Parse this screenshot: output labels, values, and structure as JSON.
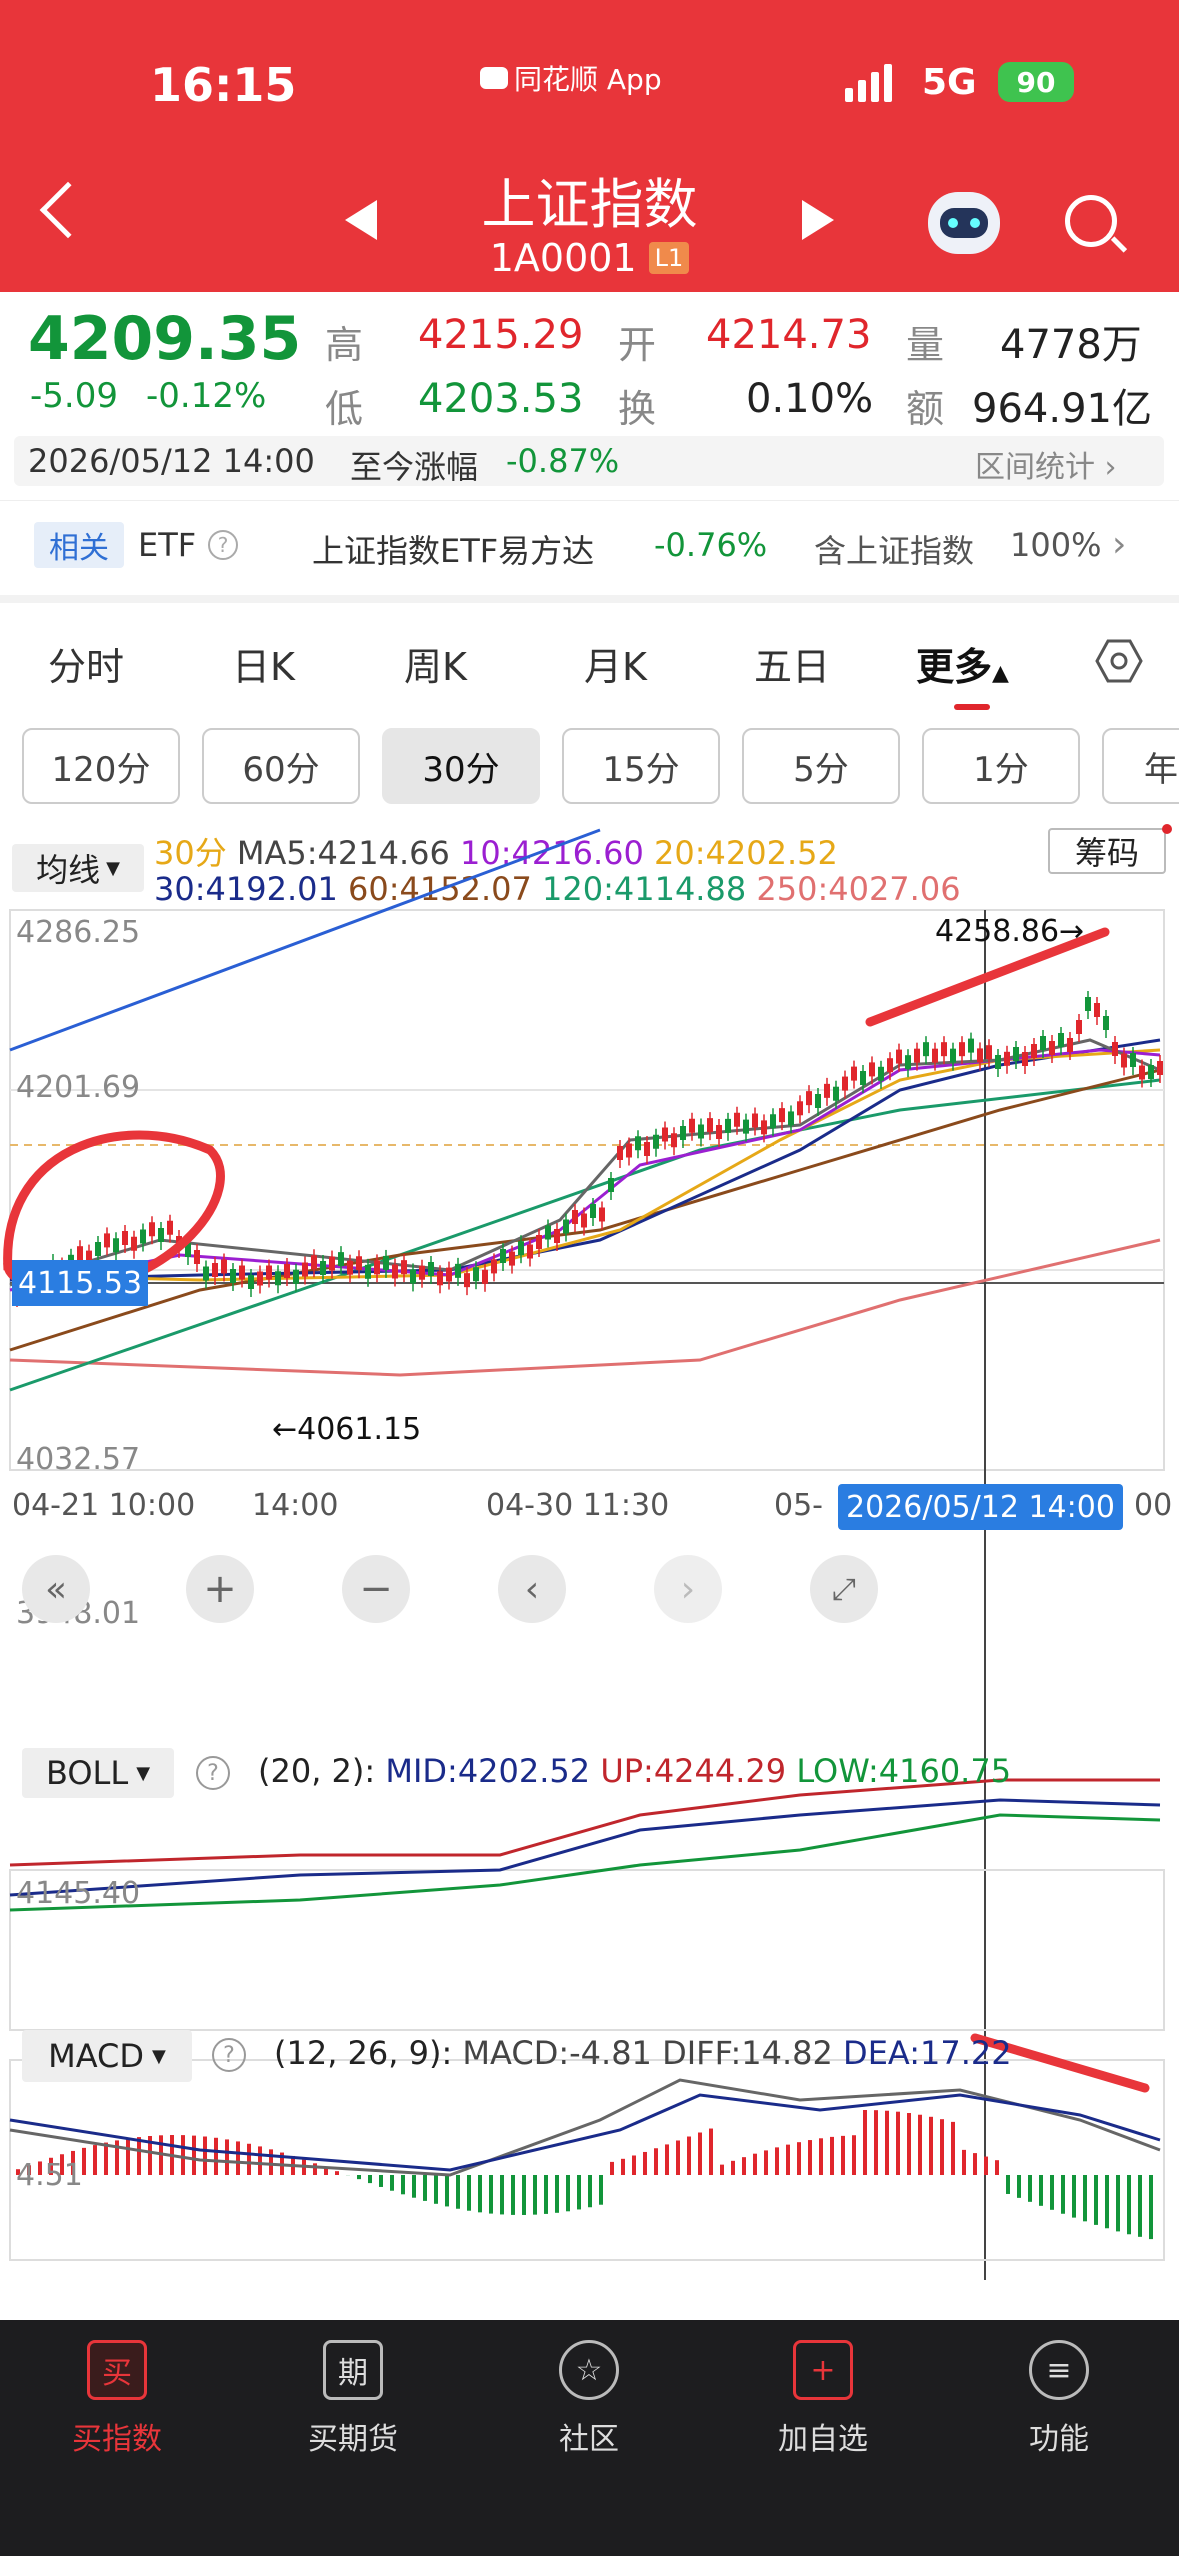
{
  "status_bar": {
    "time": "16:15",
    "center_app": "同花顺 App",
    "network": "5G",
    "battery": "90"
  },
  "header": {
    "title": "上证指数",
    "code": "1A0001",
    "level_badge": "L1"
  },
  "quote": {
    "price": "4209.35",
    "change": "-5.09",
    "change_pct": "-0.12%",
    "high_label": "高",
    "high": "4215.29",
    "open_label": "开",
    "open": "4214.73",
    "volume_label": "量",
    "volume": "4778万",
    "low_label": "低",
    "low": "4203.53",
    "turnover_label": "换",
    "turnover": "0.10%",
    "amount_label": "额",
    "amount": "964.91亿",
    "date_time": "2026/05/12 14:00",
    "since_label": "至今涨幅",
    "since_value": "-0.87%",
    "range_stats": "区间统计"
  },
  "etf_bar": {
    "tag": "相关",
    "etf_label": "ETF",
    "etf_name": "上证指数ETF易方达",
    "etf_change": "-0.76%",
    "contains_label": "含上证指数",
    "contains_value": "100%"
  },
  "period_tabs": [
    "分时",
    "日K",
    "周K",
    "月K",
    "五日",
    "更多"
  ],
  "interval_chips": [
    "120分",
    "60分",
    "30分",
    "15分",
    "5分",
    "1分",
    "年"
  ],
  "ma_legend": {
    "selector": "均线",
    "period": "30分",
    "ma5": "MA5:4214.66",
    "ma10": "10:4216.60",
    "ma20": "20:4202.52",
    "ma30": "30:4192.01",
    "ma60": "60:4152.07",
    "ma120": "120:4114.88",
    "ma250": "250:4027.06",
    "chips_button": "筹码"
  },
  "main_axis": {
    "y1": "4286.25",
    "y2": "4201.69",
    "y3": "4032.57",
    "y4": "3948.01",
    "cursor_price": "4115.53"
  },
  "annotations": {
    "high": "4258.86→",
    "low": "←4061.15"
  },
  "time_axis": {
    "t1": "04-21 10:00",
    "t2": "14:00",
    "t3": "04-30 11:30",
    "t4": "05-",
    "cursor_time": "2026/05/12 14:00",
    "t5": "00"
  },
  "boll": {
    "name": "BOLL",
    "params": "(20, 2):",
    "mid": "MID:4202.52",
    "up": "UP:4244.29",
    "low": "LOW:4160.75",
    "axis": "4145.40"
  },
  "macd": {
    "name": "MACD",
    "params": "(12, 26, 9):",
    "macd": "MACD:-4.81",
    "diff": "DIFF:14.82",
    "dea": "DEA:17.22",
    "axis": "4.51"
  },
  "bottom_nav": [
    {
      "icon": "买",
      "label": "买指数"
    },
    {
      "icon": "期",
      "label": "买期货"
    },
    {
      "icon": "☆",
      "label": "社区"
    },
    {
      "icon": "+",
      "label": "加自选"
    },
    {
      "icon": "≡",
      "label": "功能"
    }
  ],
  "colors": {
    "up": "#e0262c",
    "down": "#12953a",
    "header": "#e8353a",
    "ma5": "#555555",
    "ma10": "#9b1fd1",
    "ma20": "#e6a817",
    "ma30": "#1a2b8a",
    "ma60": "#8a4a1c",
    "ma120": "#1a9a6a",
    "ma250": "#e07070"
  }
}
